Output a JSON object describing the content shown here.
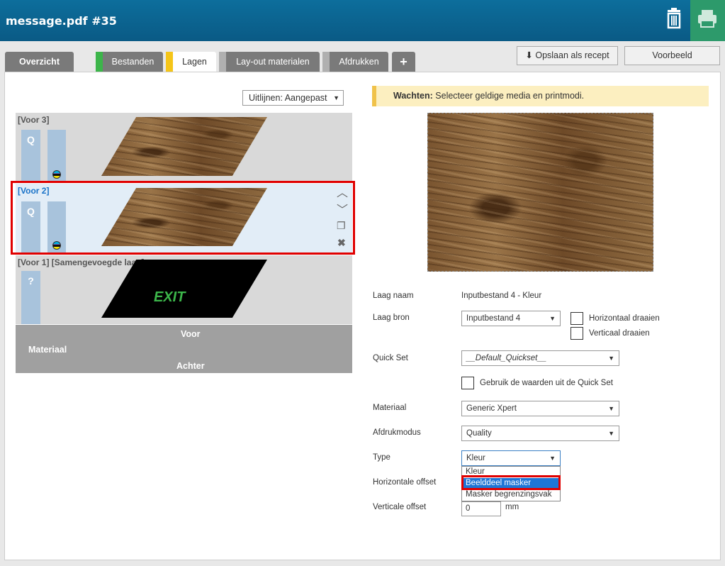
{
  "header": {
    "title": "message.pdf #35"
  },
  "tabs": [
    {
      "label": "Overzicht"
    },
    {
      "label": "Bestanden"
    },
    {
      "label": "Lagen"
    },
    {
      "label": "Lay-out materialen"
    },
    {
      "label": "Afdrukken"
    },
    {
      "label": "+"
    }
  ],
  "toolbar": {
    "save_recipe": "Opslaan als recept",
    "preview": "Voorbeeld"
  },
  "left": {
    "align_select": "Uitlijnen: Aangepast",
    "layers": [
      {
        "name": "[Voor 3]",
        "q": "Q"
      },
      {
        "name": "[Voor 2]",
        "q": "Q"
      },
      {
        "name": "[Voor 1] [Samengevoegde laag]",
        "q": "?",
        "exit_text": "EXIT"
      }
    ],
    "material": {
      "label": "Materiaal",
      "front": "Voor",
      "back": "Achter"
    }
  },
  "warning": {
    "bold": "Wachten:",
    "text": "Selecteer geldige media en printmodi."
  },
  "form": {
    "layer_name_label": "Laag naam",
    "layer_name_value": "Inputbestand 4 - Kleur",
    "layer_source_label": "Laag bron",
    "layer_source_value": "Inputbestand 4",
    "flip_h": "Horizontaal draaien",
    "flip_v": "Verticaal draaien",
    "quickset_label": "Quick Set",
    "quickset_value": "__Default_Quickset__",
    "use_quickset": "Gebruik de waarden uit de Quick Set",
    "material_label": "Materiaal",
    "material_value": "Generic Xpert",
    "printmode_label": "Afdrukmodus",
    "printmode_value": "Quality",
    "type_label": "Type",
    "type_value": "Kleur",
    "type_options": [
      "Kleur",
      "Beelddeel masker",
      "Masker begrenzingsvak"
    ],
    "h_offset_label": "Horizontale offset",
    "v_offset_label": "Verticale offset",
    "v_offset_value": "0",
    "unit": "mm"
  },
  "colors": {
    "header": "#0a5a85",
    "accent_green": "#2d9a6b",
    "highlight": "#e00000"
  }
}
